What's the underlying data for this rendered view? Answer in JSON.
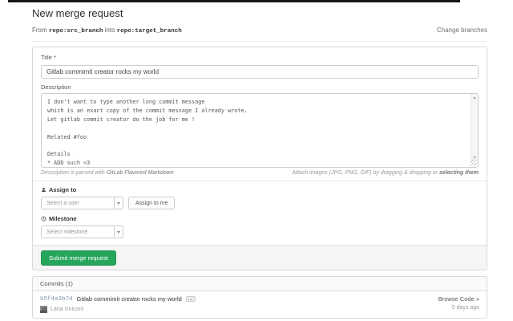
{
  "page": {
    "title": "New merge request",
    "from_label": "From",
    "source_branch": "repo:src_branch",
    "into_label": "into",
    "target_branch": "repo:target_branch",
    "change_branches_label": "Change branches"
  },
  "form": {
    "title_label": "Title *",
    "title_value": "Gitlab commimit creator rocks my world",
    "description_label": "Description",
    "description_value": "I don't want to type another long commit message\nwhich is an exact copy of the commit message I already wrote.\nLet gitlab commit creator do the job for me !\n\nRelated #foo\n\nDetails\n* ADD such <3",
    "markdown_hint_prefix": "Description is parsed with",
    "markdown_hint_link": "GitLab Flavored Markdown",
    "attach_hint": "Attach images (JPG, PNG, GIF) by dragging & dropping or ",
    "attach_hint_link": "selecting them",
    "assign_label": "Assign to",
    "assign_placeholder": "Select a user",
    "assign_to_me_label": "Assign to me",
    "milestone_label": "Milestone",
    "milestone_placeholder": "Select milestone",
    "submit_label": "Submit merge request"
  },
  "commits": {
    "header": "Commits (1)",
    "items": [
      {
        "sha": "b5f4a3b7d",
        "title": "Gitlab commimit creator rocks my world",
        "toggle": "...",
        "author": "Lana Unicorn",
        "browse_label": "Browse Code »",
        "time_ago": "5 days ago"
      }
    ]
  },
  "icons": {
    "assign-to-icon": "user-silhouette",
    "milestone-icon": "clock",
    "select-caret-icon": "caret-down",
    "textarea-resize-icon": "grip-corner",
    "commit-toggle-icon": "ellipsis"
  },
  "colors": {
    "accent_green": "#26a65b",
    "panel_border": "#d8d8d8",
    "muted_text": "#999999",
    "top_strip": "#161616"
  }
}
